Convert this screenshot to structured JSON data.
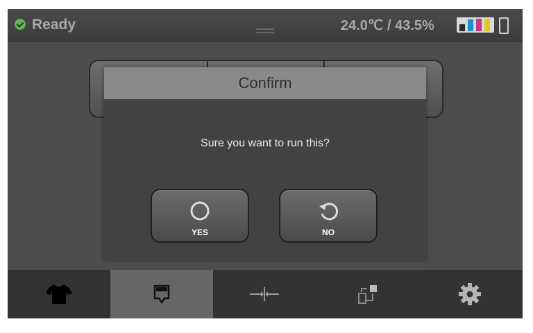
{
  "status": {
    "text": "Ready",
    "state_icon": "check-circle-icon"
  },
  "environment": {
    "reading": "24.0℃ / 43.5%"
  },
  "ink_colors": [
    "#2b2b2b",
    "#1f8fd0",
    "#c23a8e",
    "#e8c520"
  ],
  "dialog": {
    "title": "Confirm",
    "message": "Sure you want to run this?",
    "yes_label": "YES",
    "no_label": "NO"
  },
  "nav_tabs": [
    {
      "icon": "tshirt-icon",
      "active": false
    },
    {
      "icon": "platen-icon",
      "active": true
    },
    {
      "icon": "adjust-icon",
      "active": false
    },
    {
      "icon": "transfer-icon",
      "active": false
    },
    {
      "icon": "gear-icon",
      "active": false
    }
  ]
}
